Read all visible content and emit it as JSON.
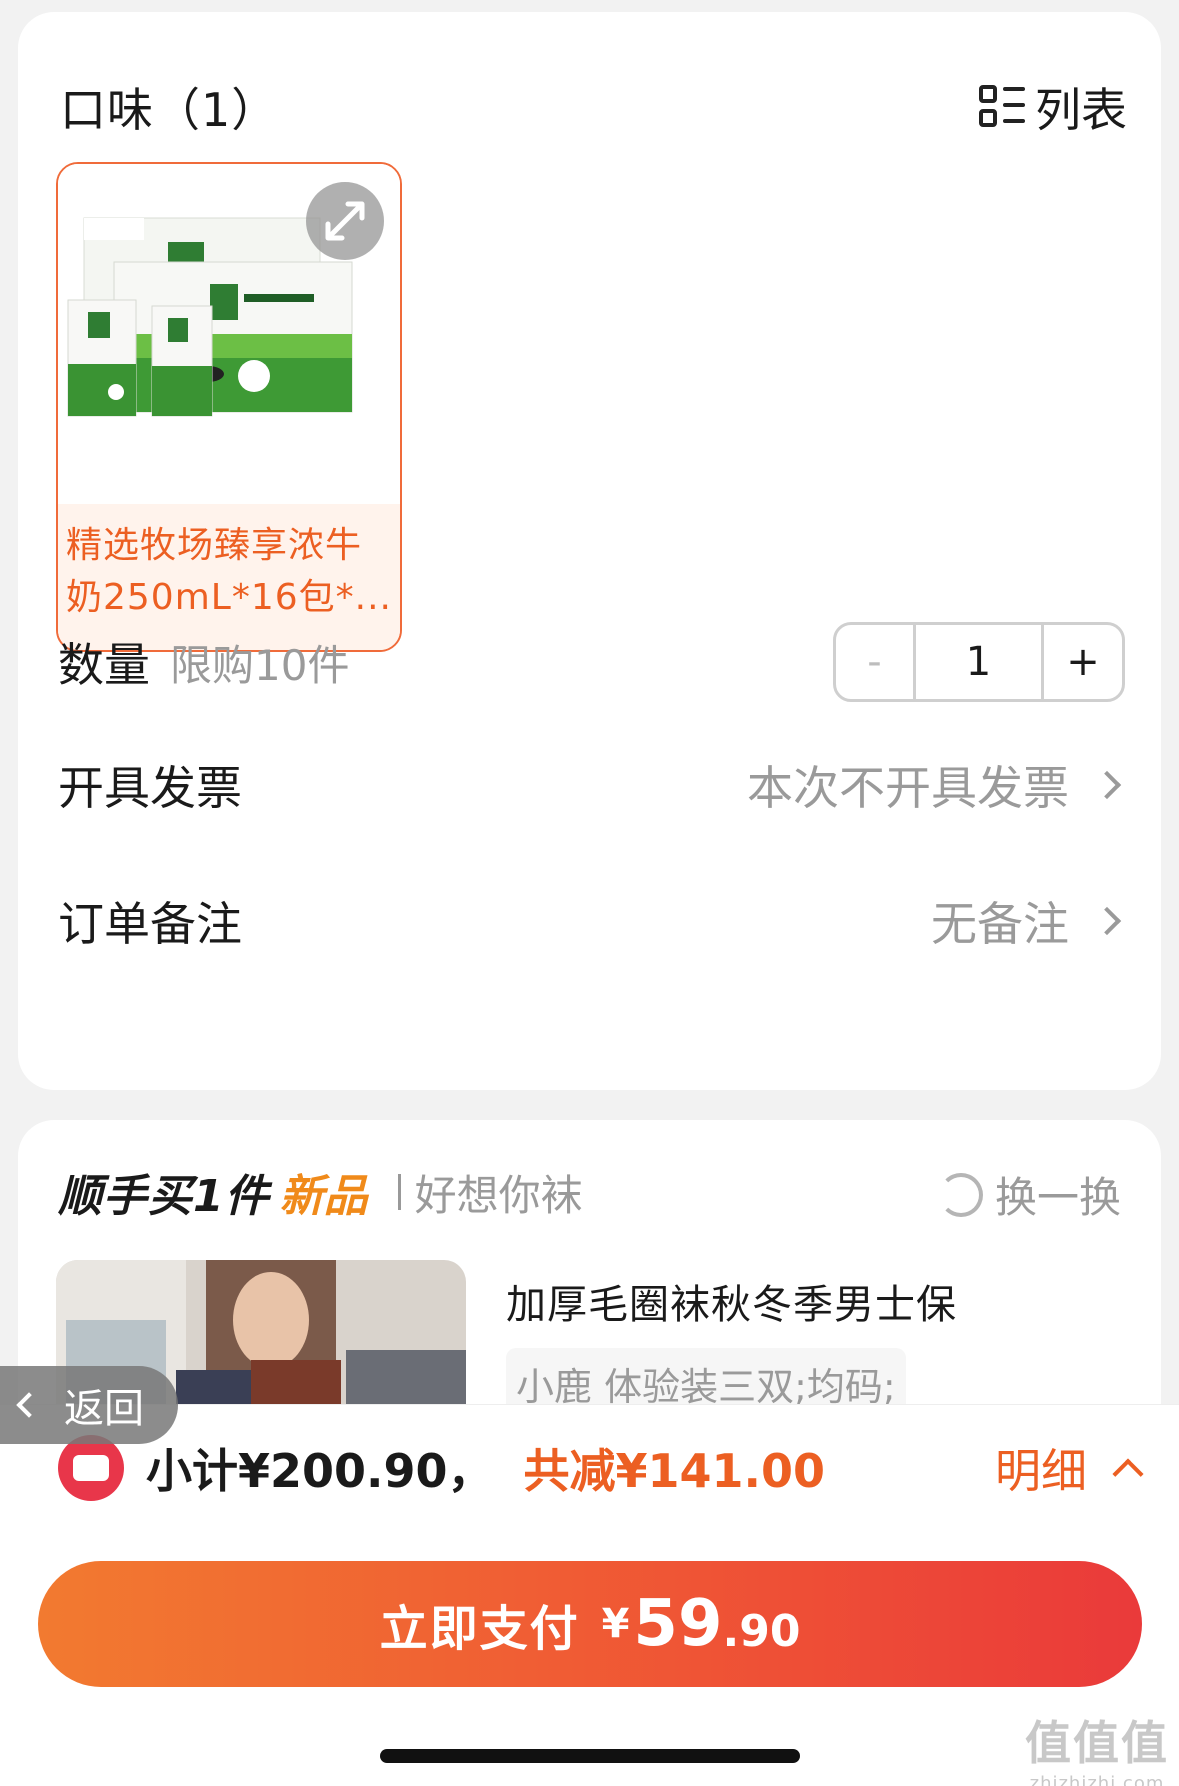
{
  "flavor": {
    "title": "口味（1）",
    "view_toggle_label": "列表"
  },
  "product": {
    "name": "精选牧场臻享浓牛奶250mL*16包*..."
  },
  "quantity": {
    "label": "数量",
    "limit": "限购10件",
    "minus": "-",
    "value": "1",
    "plus": "+"
  },
  "invoice": {
    "label": "开具发票",
    "value": "本次不开具发票"
  },
  "remark": {
    "label": "订单备注",
    "value": "无备注"
  },
  "recommend": {
    "title": "顺手买1件",
    "badge": "新品",
    "subtitle": "好想你袜",
    "swap_label": "换一换",
    "item_name": "加厚毛圈袜秋冬季男士保",
    "item_spec": "小鹿 体验装三双;均码;"
  },
  "back": {
    "label": "返回"
  },
  "summary": {
    "subtotal": "小计¥200.90，",
    "discount": "共减¥141.00",
    "detail_label": "明细"
  },
  "pay": {
    "label": "立即支付",
    "currency": "¥",
    "integer": "59",
    "decimal": ".90"
  },
  "watermark": {
    "logo": "值值值",
    "url": "zhizhizhi.com"
  },
  "colors": {
    "accent": "#ec5f22",
    "pay_start": "#f27a30",
    "pay_end": "#ea3a3a",
    "coupon": "#e8364a"
  }
}
